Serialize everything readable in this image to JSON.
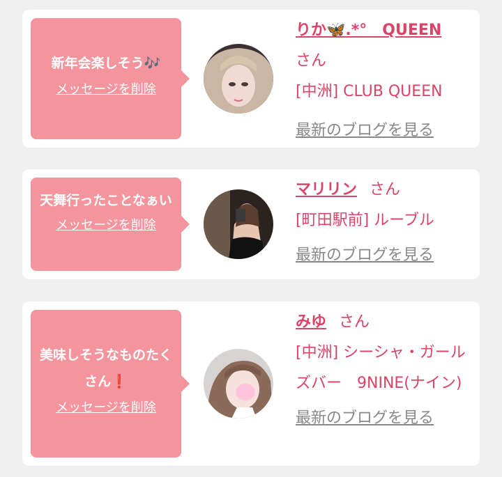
{
  "common": {
    "san": "さん",
    "delete_label": "メッセージを削除",
    "blog_link": "最新のブログを見る"
  },
  "items": [
    {
      "message": "新年会楽しそう",
      "message_emoji": "🎶",
      "name": "りか🦋.*°　QUEEN",
      "shop": "[中洲] CLUB QUEEN"
    },
    {
      "message": "天舞行ったことなぁい",
      "message_emoji": "",
      "name": "マリリン",
      "shop": "[町田駅前] ルーブル"
    },
    {
      "message": "美味しそうなものたくさん",
      "message_emoji": "❗",
      "name": "みゆ",
      "shop": "[中洲] シーシャ・ガールズバー　9NINE(ナイン)"
    }
  ],
  "colors": {
    "bubble": "#f4959e",
    "accent": "#d94467",
    "link_gray": "#888888",
    "page_bg": "#efefef"
  }
}
